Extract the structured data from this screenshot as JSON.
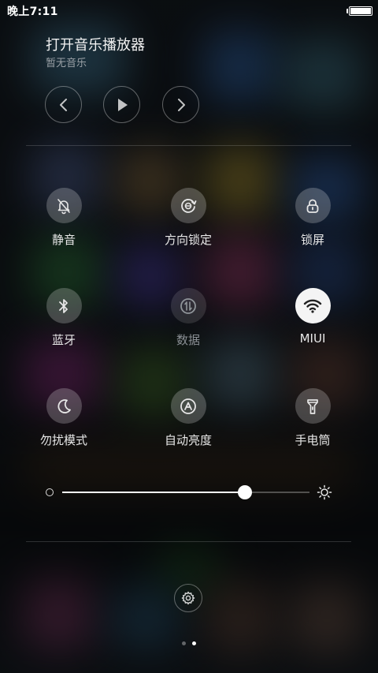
{
  "status_bar": {
    "time": "晚上7:11",
    "battery_level_percent": 100
  },
  "music": {
    "title": "打开音乐播放器",
    "subtitle": "暂无音乐",
    "controls": [
      {
        "name": "previous",
        "icon": "chevron-left-icon"
      },
      {
        "name": "play",
        "icon": "play-icon"
      },
      {
        "name": "next",
        "icon": "chevron-right-icon"
      }
    ]
  },
  "toggles": [
    {
      "id": "mute",
      "label": "静音",
      "icon": "bell-off-icon",
      "state": "off"
    },
    {
      "id": "rotation-lock",
      "label": "方向锁定",
      "icon": "rotation-lock-icon",
      "state": "off"
    },
    {
      "id": "lock-screen",
      "label": "锁屏",
      "icon": "lock-icon",
      "state": "off"
    },
    {
      "id": "bluetooth",
      "label": "蓝牙",
      "icon": "bluetooth-icon",
      "state": "off"
    },
    {
      "id": "data",
      "label": "数据",
      "icon": "data-icon",
      "state": "disabled"
    },
    {
      "id": "wifi",
      "label": "MIUI",
      "icon": "wifi-icon",
      "state": "on"
    },
    {
      "id": "do-not-disturb",
      "label": "勿扰模式",
      "icon": "moon-icon",
      "state": "off"
    },
    {
      "id": "auto-brightness",
      "label": "自动亮度",
      "icon": "auto-brightness-icon",
      "state": "off"
    },
    {
      "id": "flashlight",
      "label": "手电筒",
      "icon": "flashlight-icon",
      "state": "off"
    }
  ],
  "brightness": {
    "level_percent": 74,
    "low_icon": "brightness-low-icon",
    "high_icon": "brightness-high-icon"
  },
  "settings": {
    "icon": "gear-icon"
  },
  "pages": {
    "count": 2,
    "current": 2
  },
  "colors": {
    "accent_on": "#f4f4f4",
    "toggle_off_bg": "rgba(255,255,255,0.22)",
    "label_text": "#e8e8e8",
    "disabled_text": "#8a8f94"
  }
}
